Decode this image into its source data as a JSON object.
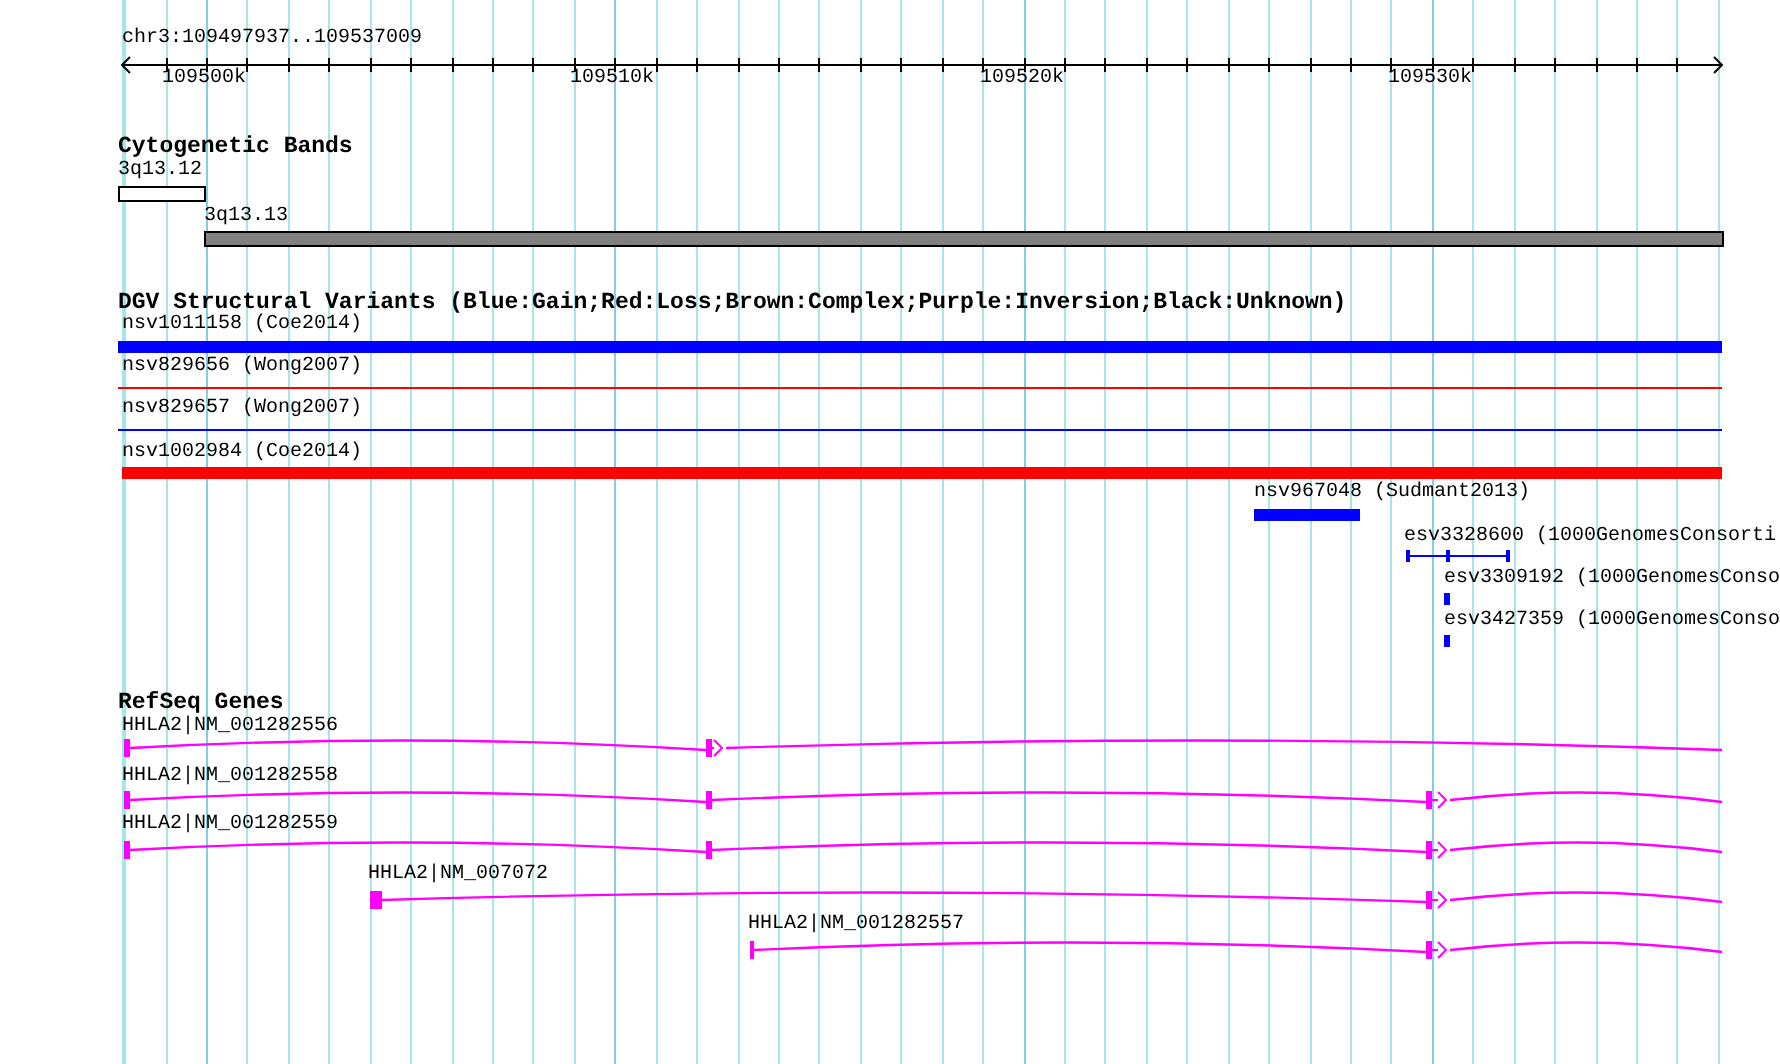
{
  "ruler": {
    "title": "chr3:109497937..109537009",
    "ticks": [
      "109500k",
      "109510k",
      "109520k",
      "109530k"
    ]
  },
  "tracks": [
    {
      "title": "Cytogenetic Bands",
      "features": [
        {
          "label": "3q13.12",
          "kind": "band",
          "color": "#ffffff"
        },
        {
          "label": "3q13.13",
          "kind": "band",
          "color": "#808080"
        }
      ]
    },
    {
      "title": "DGV Structural Variants (Blue:Gain;Red:Loss;Brown:Complex;Purple:Inversion;Black:Unknown)",
      "features": [
        {
          "label": "nsv1011158 (Coe2014)",
          "kind": "bar",
          "color": "#0000ff"
        },
        {
          "label": "nsv829656 (Wong2007)",
          "kind": "line",
          "color": "#ff0000"
        },
        {
          "label": "nsv829657 (Wong2007)",
          "kind": "line",
          "color": "#0000ff"
        },
        {
          "label": "nsv1002984 (Coe2014)",
          "kind": "bar",
          "color": "#ff0000"
        },
        {
          "label": "nsv967048 (Sudmant2013)",
          "kind": "bar",
          "color": "#0000ff"
        },
        {
          "label": "esv3328600 (1000GenomesConsorti",
          "kind": "split",
          "color": "#0000ff"
        },
        {
          "label": "esv3309192 (1000GenomesConso",
          "kind": "bar",
          "color": "#0000ff"
        },
        {
          "label": "esv3427359 (1000GenomesConso",
          "kind": "bar",
          "color": "#0000ff"
        }
      ]
    },
    {
      "title": "RefSeq Genes",
      "features": [
        {
          "label": "HHLA2|NM_001282556",
          "kind": "gene"
        },
        {
          "label": "HHLA2|NM_001282558",
          "kind": "gene"
        },
        {
          "label": "HHLA2|NM_001282559",
          "kind": "gene"
        },
        {
          "label": "HHLA2|NM_007072",
          "kind": "gene"
        },
        {
          "label": "HHLA2|NM_001282557",
          "kind": "gene"
        }
      ]
    }
  ]
}
